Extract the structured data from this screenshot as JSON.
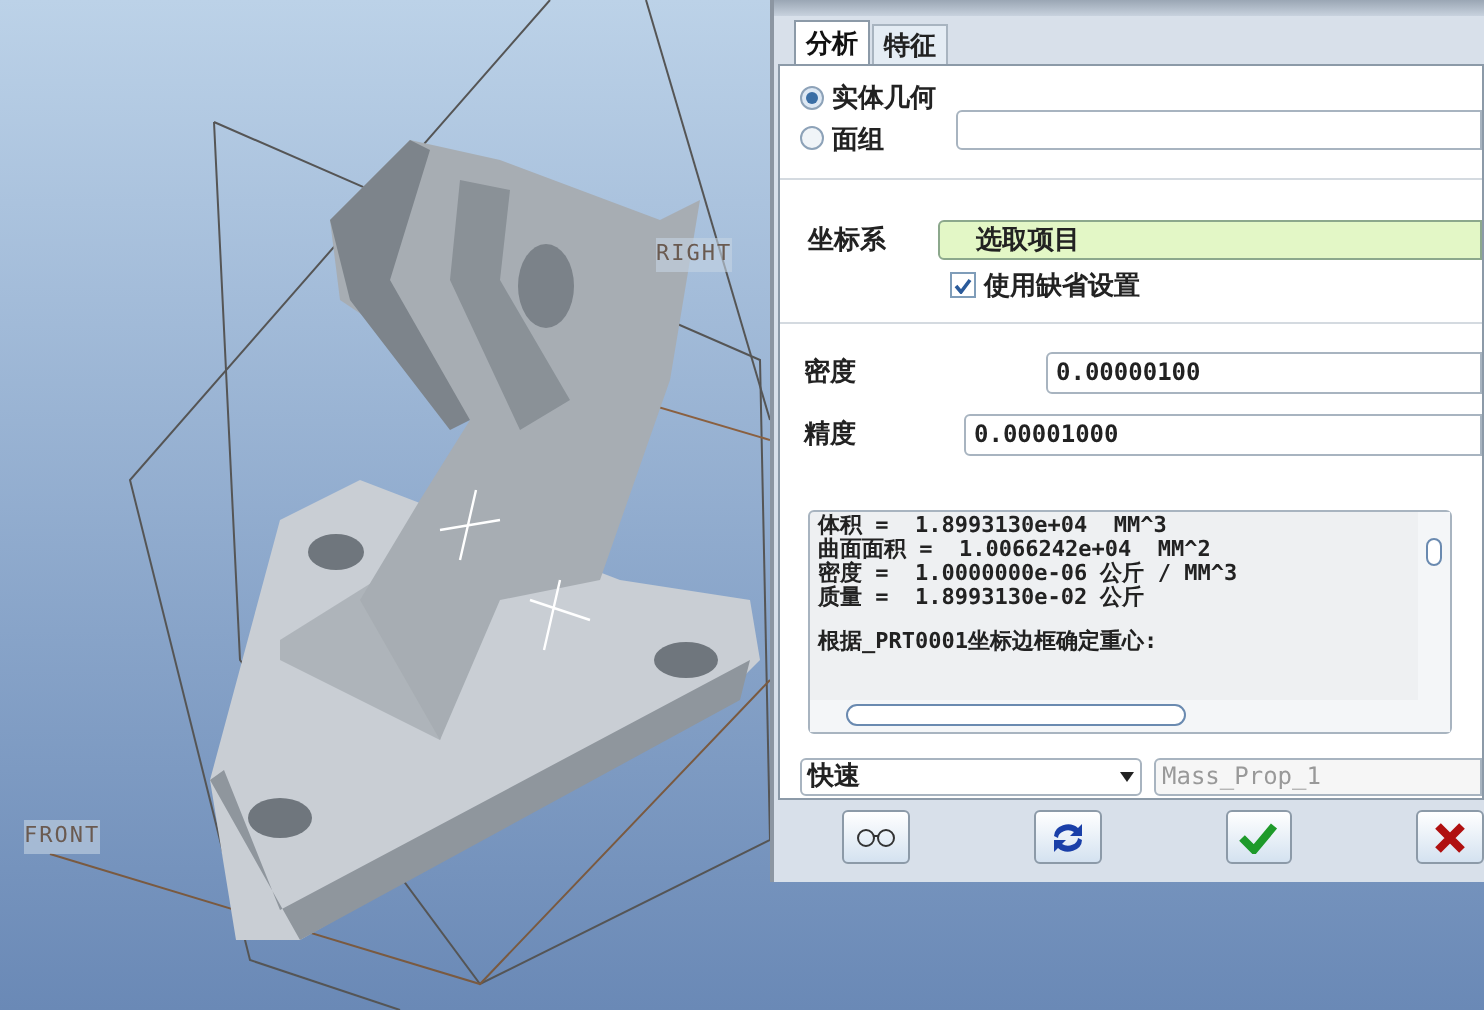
{
  "viewport": {
    "plane_labels": [
      {
        "text": "RIGHT"
      },
      {
        "text": "FRONT"
      }
    ]
  },
  "dialog": {
    "tabs": [
      {
        "label": "分析",
        "selected": true
      },
      {
        "label": "特征",
        "selected": false
      }
    ],
    "geometry_options": [
      {
        "label": "实体几何",
        "selected": true
      },
      {
        "label": "面组",
        "selected": false
      }
    ],
    "coordinate_system": {
      "label": "坐标系",
      "value": "选取项目"
    },
    "use_default": {
      "label": "使用缺省设置",
      "checked": true
    },
    "density": {
      "label": "密度",
      "value": "0.00000100"
    },
    "accuracy": {
      "label": "精度",
      "value": "0.00001000"
    },
    "results": [
      "体积 =  1.8993130e+04  MM^3",
      "曲面面积 =  1.0066242e+04  MM^2",
      "密度 =  1.0000000e-06 公斤 / MM^3",
      "质量 =  1.8993130e-02 公斤",
      "根据_PRT0001坐标边框确定重心:"
    ],
    "mode_dropdown": {
      "value": "快速"
    },
    "name_field": {
      "value": "Mass_Prop_1",
      "disabled": true
    },
    "buttons": [
      {
        "kind": "preview"
      },
      {
        "kind": "repeat"
      },
      {
        "kind": "ok"
      },
      {
        "kind": "cancel"
      }
    ]
  }
}
